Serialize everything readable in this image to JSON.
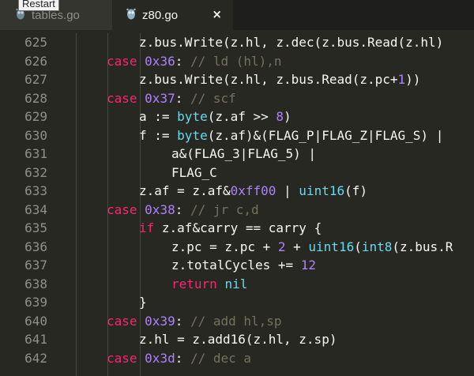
{
  "tooltip": "Restart",
  "tabs": [
    {
      "label": "tables.go",
      "icon": "gopher-icon"
    },
    {
      "label": "z80.go",
      "icon": "gopher-icon"
    }
  ],
  "close_glyph": "×",
  "colors": {
    "background": "#272822",
    "keyword": "#f92672",
    "number": "#ae81ff",
    "comment": "#75715e",
    "function": "#66d9ef",
    "text": "#f8f8f2"
  },
  "lines": [
    {
      "num": "625",
      "indent": 2,
      "tokens": [
        [
          "",
          "z.bus.Write(z.hl, z.dec(z.bus.Read(z.hl)"
        ]
      ]
    },
    {
      "num": "626",
      "indent": 1,
      "tokens": [
        [
          "kw",
          "case "
        ],
        [
          "num",
          "0x36"
        ],
        [
          "",
          ": "
        ],
        [
          "cm",
          "// ld (hl),n"
        ]
      ]
    },
    {
      "num": "627",
      "indent": 2,
      "tokens": [
        [
          "",
          "z.bus.Write(z.hl, z.bus.Read(z.pc+"
        ],
        [
          "num",
          "1"
        ],
        [
          "",
          "))"
        ]
      ]
    },
    {
      "num": "628",
      "indent": 1,
      "tokens": [
        [
          "kw",
          "case "
        ],
        [
          "num",
          "0x37"
        ],
        [
          "",
          ": "
        ],
        [
          "cm",
          "// scf"
        ]
      ]
    },
    {
      "num": "629",
      "indent": 2,
      "tokens": [
        [
          "",
          "a := "
        ],
        [
          "fn",
          "byte"
        ],
        [
          "",
          "(z.af >> "
        ],
        [
          "num",
          "8"
        ],
        [
          "",
          ")"
        ]
      ]
    },
    {
      "num": "630",
      "indent": 2,
      "tokens": [
        [
          "",
          "f := "
        ],
        [
          "fn",
          "byte"
        ],
        [
          "",
          "(z.af)&(FLAG_P|FLAG_Z|FLAG_S) |"
        ]
      ]
    },
    {
      "num": "631",
      "indent": 3,
      "tokens": [
        [
          "",
          "a&(FLAG_3|FLAG_5) |"
        ]
      ]
    },
    {
      "num": "632",
      "indent": 3,
      "tokens": [
        [
          "",
          "FLAG_C"
        ]
      ]
    },
    {
      "num": "633",
      "indent": 2,
      "tokens": [
        [
          "",
          "z.af = z.af&"
        ],
        [
          "num",
          "0xff00"
        ],
        [
          "",
          " | "
        ],
        [
          "fn",
          "uint16"
        ],
        [
          "",
          "(f)"
        ]
      ]
    },
    {
      "num": "634",
      "indent": 1,
      "tokens": [
        [
          "kw",
          "case "
        ],
        [
          "num",
          "0x38"
        ],
        [
          "",
          ": "
        ],
        [
          "cm",
          "// jr c,d"
        ]
      ]
    },
    {
      "num": "635",
      "indent": 2,
      "tokens": [
        [
          "kw",
          "if "
        ],
        [
          "",
          "z.af&carry == carry {"
        ]
      ]
    },
    {
      "num": "636",
      "indent": 3,
      "tokens": [
        [
          "",
          "z.pc = z.pc + "
        ],
        [
          "num",
          "2"
        ],
        [
          "",
          " + "
        ],
        [
          "fn",
          "uint16"
        ],
        [
          "",
          "("
        ],
        [
          "fn",
          "int8"
        ],
        [
          "",
          "(z.bus.R"
        ]
      ]
    },
    {
      "num": "637",
      "indent": 3,
      "tokens": [
        [
          "",
          "z.totalCycles += "
        ],
        [
          "num",
          "12"
        ]
      ]
    },
    {
      "num": "638",
      "indent": 3,
      "tokens": [
        [
          "kw",
          "return "
        ],
        [
          "fn",
          "nil"
        ]
      ]
    },
    {
      "num": "639",
      "indent": 2,
      "tokens": [
        [
          "",
          "}"
        ]
      ]
    },
    {
      "num": "640",
      "indent": 1,
      "tokens": [
        [
          "kw",
          "case "
        ],
        [
          "num",
          "0x39"
        ],
        [
          "",
          ": "
        ],
        [
          "cm",
          "// add hl,sp"
        ]
      ]
    },
    {
      "num": "641",
      "indent": 2,
      "tokens": [
        [
          "",
          "z.hl = z.add16(z.hl, z.sp)"
        ]
      ]
    },
    {
      "num": "642",
      "indent": 1,
      "tokens": [
        [
          "kw",
          "case "
        ],
        [
          "num",
          "0x3d"
        ],
        [
          "",
          ": "
        ],
        [
          "cm",
          "// dec a"
        ]
      ]
    }
  ]
}
